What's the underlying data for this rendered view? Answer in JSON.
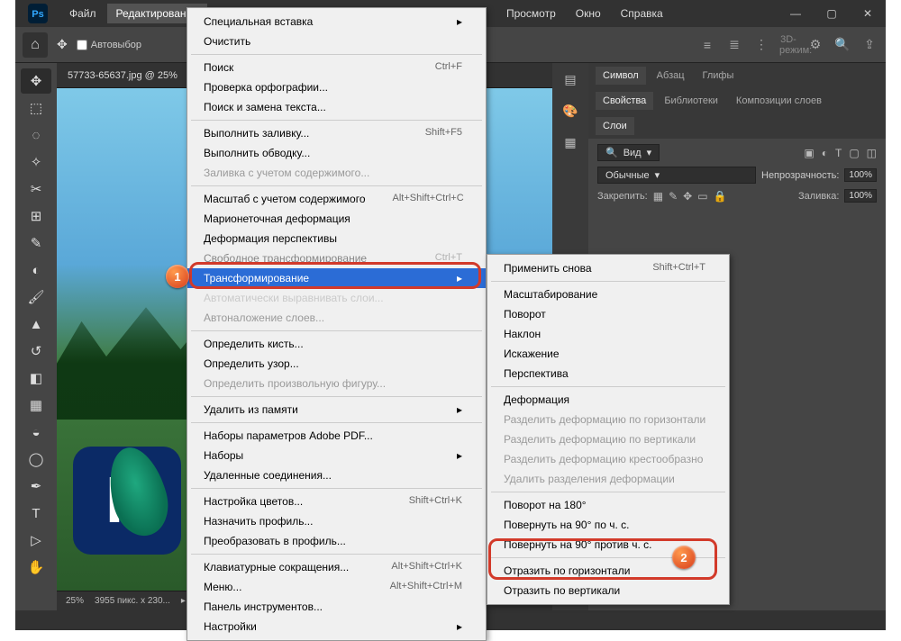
{
  "titlebar": {
    "menus": [
      "Файл",
      "Редактирование",
      "Просмотр",
      "Окно",
      "Справка"
    ],
    "active_menu_index": 1
  },
  "optbar": {
    "checkbox_label": "Автовыбор",
    "mode_label": "3D-режим:"
  },
  "document": {
    "tab_title": "57733-65637.jpg @ 25%",
    "zoom": "25%",
    "dimensions": "3955 пикс. x 230..."
  },
  "tools": [
    "↔",
    "⬚",
    "◌",
    "✂",
    "▧",
    "⊡",
    "⨉",
    "✎",
    "▲",
    "⌁",
    "✜",
    "◧",
    "⬔",
    "◐",
    "↺",
    "T",
    "▷",
    "✋"
  ],
  "right": {
    "symbol_tabs": [
      "Символ",
      "Абзац",
      "Глифы"
    ],
    "props_tabs": [
      "Свойства",
      "Библиотеки",
      "Композиции слоев"
    ],
    "layers_tab": "Слои",
    "search_label": "Вид",
    "blend_mode": "Обычные",
    "opacity_label": "Непрозрачность:",
    "opacity_value": "100%",
    "lock_label": "Закрепить:",
    "fill_label": "Заливка:",
    "fill_value": "100%"
  },
  "edit_menu": {
    "items": [
      {
        "label": "Специальная вставка",
        "enabled": true,
        "arrow": true
      },
      {
        "label": "Очистить",
        "enabled": true
      },
      {
        "sep": true
      },
      {
        "label": "Поиск",
        "shortcut": "Ctrl+F",
        "enabled": true
      },
      {
        "label": "Проверка орфографии...",
        "enabled": true
      },
      {
        "label": "Поиск и замена текста...",
        "enabled": true
      },
      {
        "sep": true
      },
      {
        "label": "Выполнить заливку...",
        "shortcut": "Shift+F5",
        "enabled": true
      },
      {
        "label": "Выполнить обводку...",
        "enabled": true
      },
      {
        "label": "Заливка с учетом содержимого...",
        "enabled": false
      },
      {
        "sep": true
      },
      {
        "label": "Масштаб с учетом содержимого",
        "shortcut": "Alt+Shift+Ctrl+C",
        "enabled": true
      },
      {
        "label": "Марионеточная деформация",
        "enabled": true
      },
      {
        "label": "Деформация перспективы",
        "enabled": true
      },
      {
        "label": "Свободное трансформирование",
        "shortcut": "Ctrl+T",
        "enabled": true,
        "obscured": true
      },
      {
        "label": "Трансформирование",
        "enabled": true,
        "arrow": true,
        "highlight": true
      },
      {
        "label": "Автоматически выравнивать слои...",
        "enabled": false,
        "obscured": true
      },
      {
        "label": "Автоналожение слоев...",
        "enabled": false
      },
      {
        "sep": true
      },
      {
        "label": "Определить кисть...",
        "enabled": true
      },
      {
        "label": "Определить узор...",
        "enabled": true
      },
      {
        "label": "Определить произвольную фигуру...",
        "enabled": false
      },
      {
        "sep": true
      },
      {
        "label": "Удалить из памяти",
        "enabled": true,
        "arrow": true
      },
      {
        "sep": true
      },
      {
        "label": "Наборы параметров Adobe PDF...",
        "enabled": true
      },
      {
        "label": "Наборы",
        "enabled": true,
        "arrow": true
      },
      {
        "label": "Удаленные соединения...",
        "enabled": true
      },
      {
        "sep": true
      },
      {
        "label": "Настройка цветов...",
        "shortcut": "Shift+Ctrl+K",
        "enabled": true
      },
      {
        "label": "Назначить профиль...",
        "enabled": true
      },
      {
        "label": "Преобразовать в профиль...",
        "enabled": true
      },
      {
        "sep": true
      },
      {
        "label": "Клавиатурные сокращения...",
        "shortcut": "Alt+Shift+Ctrl+K",
        "enabled": true
      },
      {
        "label": "Меню...",
        "shortcut": "Alt+Shift+Ctrl+M",
        "enabled": true
      },
      {
        "label": "Панель инструментов...",
        "enabled": true
      },
      {
        "label": "Настройки",
        "enabled": true,
        "arrow": true
      }
    ]
  },
  "transform_submenu": {
    "items": [
      {
        "label": "Применить снова",
        "shortcut": "Shift+Ctrl+T",
        "enabled": true
      },
      {
        "sep": true
      },
      {
        "label": "Масштабирование",
        "enabled": true
      },
      {
        "label": "Поворот",
        "enabled": true
      },
      {
        "label": "Наклон",
        "enabled": true
      },
      {
        "label": "Искажение",
        "enabled": true
      },
      {
        "label": "Перспектива",
        "enabled": true
      },
      {
        "sep": true
      },
      {
        "label": "Деформация",
        "enabled": true
      },
      {
        "label": "Разделить деформацию по горизонтали",
        "enabled": false
      },
      {
        "label": "Разделить деформацию по вертикали",
        "enabled": false
      },
      {
        "label": "Разделить деформацию крестообразно",
        "enabled": false
      },
      {
        "label": "Удалить разделения деформации",
        "enabled": false
      },
      {
        "sep": true
      },
      {
        "label": "Поворот на 180°",
        "enabled": true
      },
      {
        "label": "Повернуть на 90° по ч. с.",
        "enabled": true
      },
      {
        "label": "Повернуть на 90° против ч. с.",
        "enabled": true
      },
      {
        "sep": true
      },
      {
        "label": "Отразить по горизонтали",
        "enabled": true
      },
      {
        "label": "Отразить по вертикали",
        "enabled": true
      }
    ]
  },
  "callouts": {
    "one": "1",
    "two": "2"
  }
}
